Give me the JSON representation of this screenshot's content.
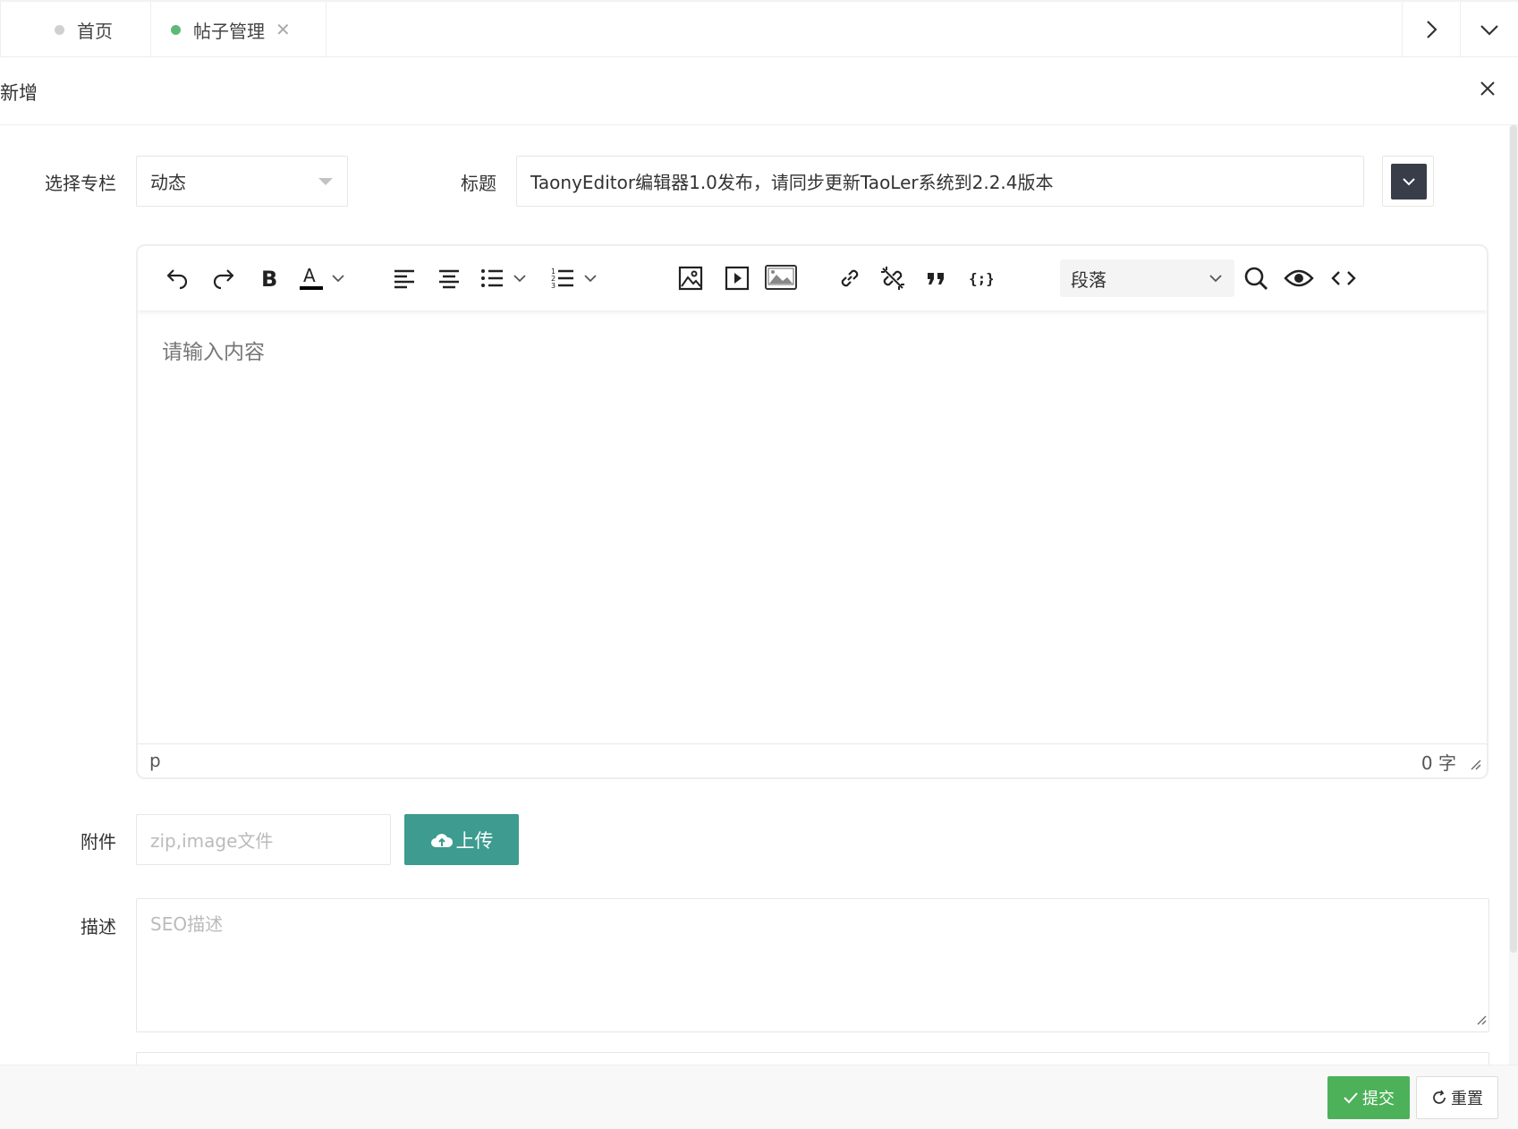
{
  "tabs": [
    {
      "label": "首页",
      "dot_color": "#d0d0d0"
    },
    {
      "label": "帖子管理",
      "dot_color": "#5fb878",
      "close": "✕"
    }
  ],
  "modal": {
    "title": "新增"
  },
  "form": {
    "column_label": "选择专栏",
    "column_value": "动态",
    "title_label": "标题",
    "title_value": "TaonyEditor编辑器1.0发布，请同步更新TaoLer系统到2.2.4版本",
    "editor": {
      "toolbar_icons": [
        "undo-icon",
        "redo-icon",
        "bold-icon",
        "font-color-icon",
        "align-left-icon",
        "align-center-icon",
        "bullet-list-icon",
        "numbered-list-icon",
        "image-icon",
        "video-icon",
        "gallery-icon",
        "link-icon",
        "unlink-icon",
        "blockquote-icon",
        "code-icon",
        "search-icon",
        "preview-icon",
        "source-code-icon"
      ],
      "block_format": "段落",
      "placeholder": "请输入内容",
      "path": "p",
      "word_count": "0 字",
      "font_color": "#000000"
    },
    "attachment_label": "附件",
    "attachment_placeholder": "zip,image文件",
    "upload_label": "上传",
    "upload_color": "#3d9b8f",
    "description_label": "描述",
    "description_placeholder": "SEO描述"
  },
  "footer": {
    "submit_label": "提交",
    "submit_color": "#4cb159",
    "reset_label": "重置"
  }
}
